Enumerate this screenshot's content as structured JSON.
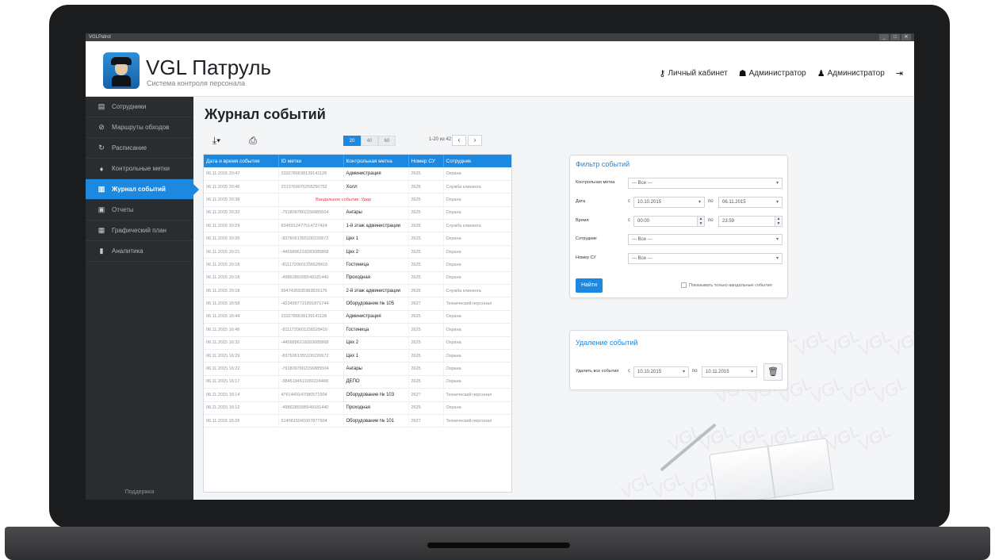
{
  "window": {
    "title": "VGLPatrol",
    "controls": [
      "_",
      "□",
      "✕"
    ]
  },
  "header": {
    "app_name": "VGL Патруль",
    "app_subtitle": "Система контроля персонала",
    "nav": [
      {
        "label": "Личный кабинет",
        "icon": "key-icon"
      },
      {
        "label": "Администратор",
        "icon": "users-icon"
      },
      {
        "label": "Администратор",
        "icon": "user-icon"
      }
    ],
    "logout_icon": "logout-icon"
  },
  "sidebar": {
    "items": [
      {
        "label": "Сотрудники",
        "icon": "id-card-icon",
        "active": false
      },
      {
        "label": "Маршруты обходов",
        "icon": "route-icon",
        "active": false
      },
      {
        "label": "Расписание",
        "icon": "schedule-icon",
        "active": false
      },
      {
        "label": "Контрольные метки",
        "icon": "map-pin-icon",
        "active": false
      },
      {
        "label": "Журнал событий",
        "icon": "journal-icon",
        "active": true
      },
      {
        "label": "Отчеты",
        "icon": "report-icon",
        "active": false
      },
      {
        "label": "Графический план",
        "icon": "map-icon",
        "active": false
      },
      {
        "label": "Аналитика",
        "icon": "analytics-icon",
        "active": false
      }
    ],
    "support_label": "Поддержка"
  },
  "main": {
    "title": "Журнал событий",
    "toolbar": {
      "download_icon": "download-icon",
      "print_icon": "print-icon"
    },
    "page_sizes": [
      {
        "label": "20",
        "selected": true
      },
      {
        "label": "40",
        "selected": false
      },
      {
        "label": "60",
        "selected": false
      }
    ],
    "pager": {
      "info": "1-20 из 42",
      "prev": "‹",
      "next": "›"
    },
    "table": {
      "columns": [
        "Дата и время события",
        "ID метки",
        "Контрольная метка",
        "Номер СУ",
        "Сотрудник"
      ],
      "rows": [
        [
          "06.11.2015 20:47",
          "2332786638139141128",
          "Администрация",
          "2625",
          "Охрана"
        ],
        [
          "06.11.2015 20:46",
          "2313769076258250752",
          "Холл",
          "2626",
          "Служба клининга"
        ],
        [
          "06.11.2015 20:38",
          "Вандальное событие: Удар",
          "",
          "2625",
          "Охрана"
        ],
        [
          "06.11.2015 20:32",
          "-7918097802156885504",
          "Ангары",
          "2625",
          "Охрана"
        ],
        [
          "06.11.2015 20:29",
          "8345912477514727424",
          "1-й этаж администрации",
          "2626",
          "Служба клининга"
        ],
        [
          "06.11.2015 20:26",
          "-8376061355100220672",
          "Цех 1",
          "2625",
          "Охрана"
        ],
        [
          "06.11.2015 20:21",
          "-4459896218283085868",
          "Цех 2",
          "2625",
          "Охрана"
        ],
        [
          "06.11.2015 20:18",
          "-8111720601156528416",
          "Гостиница",
          "2625",
          "Охрана"
        ],
        [
          "06.11.2015 20:18",
          "-4986289396549181440",
          "Проходная",
          "2625",
          "Охрана"
        ],
        [
          "06.11.2015 20:18",
          "5947435935983826176",
          "2-й этаж администрации",
          "2626",
          "Служба клининга"
        ],
        [
          "06.11.2015 16:58",
          "-4234997731891871744",
          "Оборудование № 105",
          "2627",
          "Технический персонал"
        ],
        [
          "06.11.2015 16:44",
          "2332786638139141128",
          "Администрация",
          "2625",
          "Охрана"
        ],
        [
          "06.11.2015 16:46",
          "-8111720601156528416",
          "Гостиница",
          "2625",
          "Охрана"
        ],
        [
          "06.11.2015 16:32",
          "-4459896218283085868",
          "Цех 2",
          "2625",
          "Охрана"
        ],
        [
          "06.11.2015 16:29",
          "-8376061355100220672",
          "Цех 1",
          "2625",
          "Охрана"
        ],
        [
          "06.11.2015 16:22",
          "-7918097802156885504",
          "Ангары",
          "2625",
          "Охрана"
        ],
        [
          "06.11.2015 16:17",
          "-3845194611060224408",
          "ДЕПО",
          "2625",
          "Охрана"
        ],
        [
          "06.11.2015 16:14",
          "4761449147080571904",
          "Оборудование № 103",
          "2627",
          "Технический персонал"
        ],
        [
          "06.11.2015 16:12",
          "-4986289396549181440",
          "Проходная",
          "2625",
          "Охрана"
        ],
        [
          "06.11.2015 15:26",
          "5140815041067877604",
          "Оборудование № 101",
          "2627",
          "Технический персонал"
        ]
      ],
      "alert_row_index": 2
    }
  },
  "filter": {
    "title": "Фильтр событий",
    "checkpoint_label": "Контрольная метка",
    "checkpoint_value": "--- Все ---",
    "date_label": "Дата",
    "date_from_prefix": "с",
    "date_from": "10.10.2015",
    "date_to_prefix": "по",
    "date_to": "06.11.2015",
    "time_label": "Время",
    "time_from_prefix": "с",
    "time_from": "00:00",
    "time_to_prefix": "по",
    "time_to": "23:59",
    "employee_label": "Сотрудник",
    "employee_value": "--- Все ---",
    "su_label": "Номер СУ",
    "su_value": "--- Все ---",
    "find_button": "Найти",
    "vandal_only_label": "Показывать только вандальные события"
  },
  "delete": {
    "title": "Удаление событий",
    "label": "Удалить все события",
    "from_prefix": "с",
    "from": "10.10.2015",
    "to_prefix": "по",
    "to": "10.11.2015",
    "trash_icon": "trash-icon"
  },
  "watermark_text": "VGL",
  "accent_color": "#1d88e0",
  "sidebar_color": "#2a2c30"
}
